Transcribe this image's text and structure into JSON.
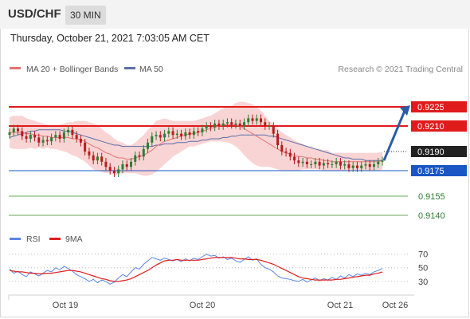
{
  "header": {
    "symbol": "USD/CHF",
    "timeframe": "30 MIN"
  },
  "datetime": "Thursday, October 21, 2021 7:03:05 AM CET",
  "legend": {
    "ma20_label": "MA 20 + Bollinger Bands",
    "ma50_label": "MA 50",
    "copyright": "Research © 2021 Trading Central",
    "rsi_label": "RSI",
    "rsi9_label": "9MA"
  },
  "colors": {
    "candle_up": "#2e7d32",
    "candle_down": "#b71c1c",
    "bollinger_band": "#f7c6c6",
    "ma20": "#e57373",
    "ma50": "#5a6fa8",
    "resistance": "#e01b1b",
    "pivot": "#1a56c4",
    "support": "#6aaa5a",
    "rsi": "#5b86e5",
    "rsi_ma": "#e02020",
    "arrow": "#2a5ca8"
  },
  "chart_data": [
    {
      "type": "candlestick",
      "ylim": [
        0.9125,
        0.9245
      ],
      "x_ticks": [
        "Oct 19",
        "Oct 20",
        "Oct 21",
        "Oct 26"
      ],
      "levels": [
        {
          "label": "0.9225",
          "value": 0.9225,
          "kind": "resistance"
        },
        {
          "label": "0.9210",
          "value": 0.921,
          "kind": "resistance"
        },
        {
          "label": "0.9190",
          "value": 0.919,
          "kind": "last"
        },
        {
          "label": "0.9175",
          "value": 0.9175,
          "kind": "pivot"
        },
        {
          "label": "0.9155",
          "value": 0.9155,
          "kind": "support"
        },
        {
          "label": "0.9140",
          "value": 0.914,
          "kind": "support"
        }
      ],
      "closes": [
        0.9205,
        0.9208,
        0.9206,
        0.9202,
        0.92,
        0.9203,
        0.9201,
        0.9197,
        0.9199,
        0.9198,
        0.9201,
        0.9203,
        0.92,
        0.9205,
        0.9207,
        0.9203,
        0.92,
        0.9197,
        0.919,
        0.9187,
        0.9183,
        0.9186,
        0.9182,
        0.9178,
        0.9175,
        0.9173,
        0.9176,
        0.918,
        0.9178,
        0.9182,
        0.9187,
        0.9186,
        0.9192,
        0.9197,
        0.9202,
        0.9203,
        0.9201,
        0.9204,
        0.9206,
        0.9203,
        0.9204,
        0.9202,
        0.9205,
        0.9203,
        0.9206,
        0.9205,
        0.9208,
        0.921,
        0.9209,
        0.9212,
        0.921,
        0.9212,
        0.9213,
        0.9211,
        0.9212,
        0.921,
        0.9213,
        0.9216,
        0.9214,
        0.9216,
        0.9213,
        0.921,
        0.921,
        0.9204,
        0.9195,
        0.919,
        0.9189,
        0.9186,
        0.9183,
        0.9181,
        0.9182,
        0.918,
        0.918,
        0.9182,
        0.9179,
        0.9181,
        0.918,
        0.918,
        0.9182,
        0.9179,
        0.918,
        0.9177,
        0.9179,
        0.9177,
        0.9179,
        0.918,
        0.9178,
        0.918,
        0.9182,
        0.9183
      ],
      "ma20": [
        0.9205,
        0.9205,
        0.9205,
        0.9205,
        0.9204,
        0.9204,
        0.9203,
        0.9203,
        0.9202,
        0.9202,
        0.9201,
        0.9201,
        0.9201,
        0.9201,
        0.9201,
        0.92,
        0.92,
        0.9199,
        0.9198,
        0.9196,
        0.9194,
        0.9193,
        0.9191,
        0.9189,
        0.9188,
        0.9186,
        0.9185,
        0.9185,
        0.9184,
        0.9184,
        0.9185,
        0.9186,
        0.9187,
        0.9189,
        0.9191,
        0.9194,
        0.9196,
        0.9198,
        0.9199,
        0.92,
        0.9201,
        0.9202,
        0.9203,
        0.9204,
        0.9204,
        0.9205,
        0.9206,
        0.9207,
        0.9208,
        0.9209,
        0.921,
        0.9211,
        0.9211,
        0.9211,
        0.9211,
        0.921,
        0.9208,
        0.9206,
        0.9204,
        0.9202,
        0.92,
        0.9198,
        0.9196,
        0.9194,
        0.9192,
        0.919,
        0.9189,
        0.9188,
        0.9187,
        0.9186,
        0.9186,
        0.9185,
        0.9185,
        0.9184,
        0.9184,
        0.9183,
        0.9183,
        0.9182,
        0.9182,
        0.9182,
        0.9182,
        0.9182,
        0.9182,
        0.9182,
        0.9182,
        0.9182,
        0.9182,
        0.9182,
        0.9182,
        0.9183
      ],
      "ma50": [
        0.9201,
        0.9202,
        0.9203,
        0.9204,
        0.9205,
        0.9206,
        0.9206,
        0.9207,
        0.9207,
        0.9207,
        0.9207,
        0.9207,
        0.9207,
        0.9206,
        0.9206,
        0.9205,
        0.9204,
        0.9203,
        0.9202,
        0.9201,
        0.92,
        0.9199,
        0.9198,
        0.9197,
        0.9196,
        0.9195,
        0.9195,
        0.9194,
        0.9194,
        0.9194,
        0.9194,
        0.9194,
        0.9194,
        0.9194,
        0.9194,
        0.9195,
        0.9195,
        0.9196,
        0.9196,
        0.9196,
        0.9197,
        0.9197,
        0.9197,
        0.9198,
        0.9198,
        0.9198,
        0.9199,
        0.9199,
        0.92,
        0.92,
        0.92,
        0.9201,
        0.9201,
        0.9202,
        0.9202,
        0.9203,
        0.9203,
        0.9203,
        0.9203,
        0.9203,
        0.9203,
        0.9203,
        0.9202,
        0.9202,
        0.9201,
        0.92,
        0.9199,
        0.9198,
        0.9197,
        0.9196,
        0.9195,
        0.9194,
        0.9193,
        0.9192,
        0.9191,
        0.919,
        0.9189,
        0.9188,
        0.9187,
        0.9186,
        0.9185,
        0.9185,
        0.9184,
        0.9184,
        0.9184,
        0.9183,
        0.9183,
        0.9183,
        0.9183,
        0.9183
      ],
      "bb_width": [
        0.0012,
        0.0013,
        0.0013,
        0.0013,
        0.0012,
        0.0011,
        0.0011,
        0.001,
        0.001,
        0.0009,
        0.0009,
        0.0009,
        0.001,
        0.0011,
        0.0012,
        0.0013,
        0.0014,
        0.0015,
        0.0016,
        0.0017,
        0.0018,
        0.0018,
        0.0017,
        0.0016,
        0.0015,
        0.0014,
        0.0013,
        0.0012,
        0.0011,
        0.0011,
        0.0012,
        0.0014,
        0.0016,
        0.0018,
        0.0019,
        0.002,
        0.0019,
        0.0018,
        0.0016,
        0.0014,
        0.0013,
        0.0012,
        0.0011,
        0.001,
        0.001,
        0.001,
        0.001,
        0.001,
        0.001,
        0.0011,
        0.0012,
        0.0013,
        0.0014,
        0.0015,
        0.0017,
        0.0019,
        0.0021,
        0.0022,
        0.0023,
        0.0023,
        0.0022,
        0.002,
        0.0018,
        0.0017,
        0.0016,
        0.0015,
        0.0014,
        0.0013,
        0.0012,
        0.0011,
        0.001,
        0.0009,
        0.0009,
        0.0008,
        0.0008,
        0.0008,
        0.0008,
        0.0007,
        0.0007,
        0.0007,
        0.0007,
        0.0007,
        0.0007,
        0.0007,
        0.0007,
        0.0007,
        0.0007,
        0.0007,
        0.0007,
        0.0007
      ],
      "projection_target": 0.9225
    },
    {
      "type": "line",
      "ylim": [
        10,
        80
      ],
      "y_ticks": [
        70,
        50,
        30
      ],
      "series": [
        {
          "name": "RSI",
          "values": [
            48,
            42,
            45,
            40,
            37,
            44,
            41,
            38,
            42,
            46,
            44,
            50,
            47,
            52,
            49,
            45,
            40,
            37,
            34,
            30,
            33,
            28,
            32,
            30,
            26,
            29,
            35,
            40,
            37,
            44,
            50,
            48,
            55,
            60,
            65,
            63,
            61,
            64,
            62,
            60,
            62,
            59,
            63,
            60,
            64,
            62,
            66,
            70,
            67,
            68,
            64,
            66,
            62,
            64,
            60,
            58,
            62,
            66,
            61,
            63,
            55,
            50,
            48,
            44,
            38,
            35,
            34,
            33,
            31,
            30,
            33,
            29,
            32,
            35,
            31,
            34,
            32,
            36,
            33,
            38,
            35,
            40,
            37,
            41,
            39,
            42,
            40,
            44,
            46,
            49
          ]
        },
        {
          "name": "9MA",
          "values": [
            46,
            45,
            44,
            44,
            43,
            42,
            42,
            41,
            41,
            42,
            42,
            43,
            44,
            45,
            46,
            46,
            45,
            44,
            42,
            40,
            38,
            36,
            34,
            33,
            31,
            30,
            30,
            31,
            32,
            34,
            37,
            40,
            43,
            46,
            50,
            54,
            57,
            60,
            61,
            61,
            62,
            61,
            61,
            61,
            61,
            61,
            62,
            63,
            64,
            65,
            65,
            65,
            65,
            65,
            64,
            63,
            63,
            62,
            62,
            62,
            61,
            59,
            57,
            55,
            52,
            49,
            46,
            43,
            40,
            37,
            35,
            34,
            33,
            32,
            32,
            32,
            32,
            32,
            33,
            33,
            34,
            35,
            36,
            37,
            38,
            39,
            39,
            41,
            42,
            44
          ]
        }
      ]
    }
  ]
}
